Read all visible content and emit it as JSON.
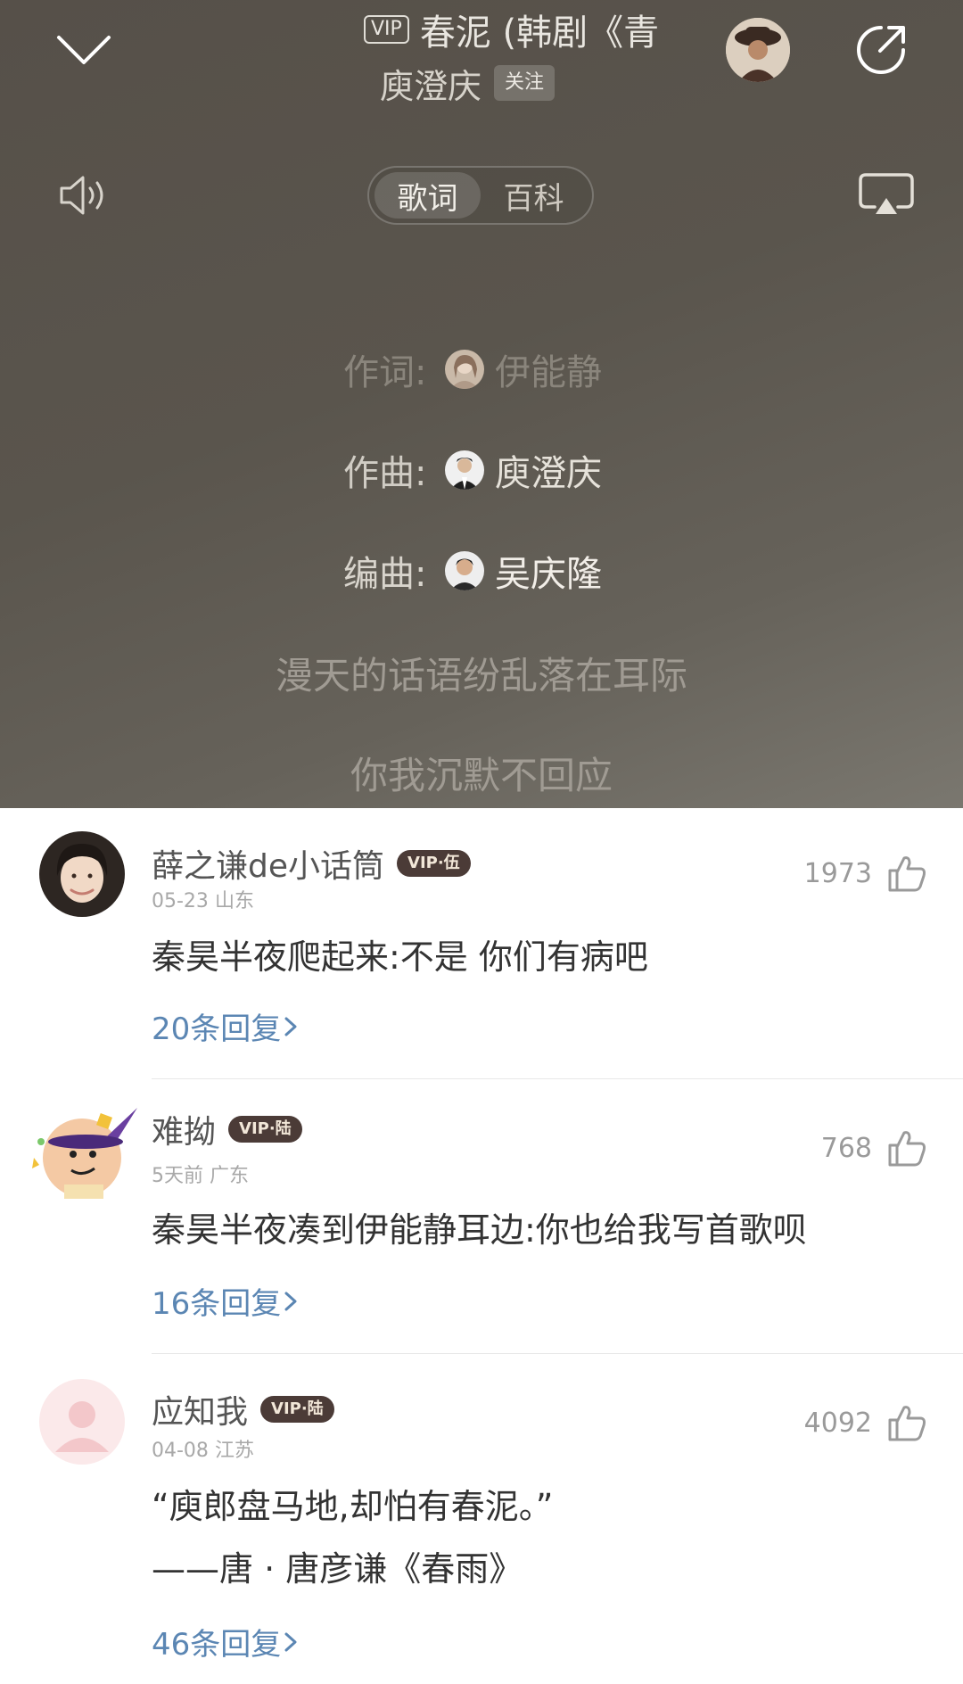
{
  "header": {
    "vip_tag": "VIP",
    "song_title": "春泥 (韩剧《青",
    "artist": "庾澄庆",
    "follow_label": "关注"
  },
  "tabs": [
    {
      "label": "歌词",
      "active": true
    },
    {
      "label": "百科",
      "active": false
    }
  ],
  "credits": [
    {
      "label": "作词:",
      "name": "伊能静",
      "color": "#8a857c"
    },
    {
      "label": "作曲:",
      "name": "庾澄庆",
      "color": "#d8d4cc"
    },
    {
      "label": "编曲:",
      "name": "吴庆隆",
      "color": "#e8e4dc"
    }
  ],
  "lyrics": [
    "漫天的话语纷乱落在耳际",
    "你我沉默不回应"
  ],
  "comments": [
    {
      "user": "薛之谦de小话筒",
      "vip": "VIP·伍",
      "date": "05-23",
      "location": "山东",
      "likes": "1973",
      "lines": [
        "秦昊半夜爬起来:不是 你们有病吧"
      ],
      "replies": "20条回复"
    },
    {
      "user": "难拗",
      "vip": "VIP·陆",
      "date": "5天前",
      "location": "广东",
      "likes": "768",
      "lines": [
        "秦昊半夜凑到伊能静耳边:你也给我写首歌呗"
      ],
      "replies": "16条回复"
    },
    {
      "user": "应知我",
      "vip": "VIP·陆",
      "date": "04-08",
      "location": "江苏",
      "likes": "4092",
      "lines": [
        "“庾郎盘马地,却怕有春泥。”",
        "——唐 · 唐彦谦《春雨》"
      ],
      "replies": "46条回复"
    }
  ]
}
